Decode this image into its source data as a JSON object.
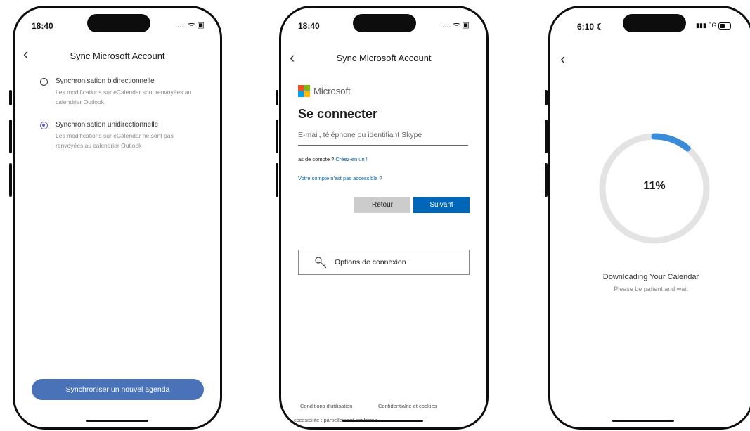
{
  "phone1": {
    "status": {
      "time": "18:40",
      "icons": "..... ᯤ ▣"
    },
    "nav": {
      "back_glyph": "‹",
      "title": "Sync Microsoft Account"
    },
    "options": [
      {
        "title": "Synchronisation bidirectionnelle",
        "desc": "Les modifications sur eCalendar sont renvoyées au calendrier Outlook.",
        "selected": false
      },
      {
        "title": "Synchronisation unidirectionnelle",
        "desc": "Les modifications sur eCalendar ne sont pas renvoyées au calendrier Outlook",
        "selected": true
      }
    ],
    "primary_button": "Synchroniser un nouvel agenda"
  },
  "phone2": {
    "status": {
      "time": "18:40",
      "icons": "..... ᯤ ▣"
    },
    "nav": {
      "back_glyph": "‹",
      "title": "Sync Microsoft Account"
    },
    "brand": "Microsoft",
    "heading": "Se connecter",
    "email_placeholder": "E-mail, téléphone ou identifiant Skype",
    "no_account_prefix": "as de compte ? ",
    "create_link": "Créez-en un !",
    "inaccessible_link": "Votre compte n'est pas accessible ?",
    "back_button": "Retour",
    "next_button": "Suivant",
    "signin_options": "Options de connexion",
    "footer_terms": "Conditions d'utilisation",
    "footer_privacy": "Confidentialité et cookies",
    "footer_access": "ccessibilité : partiellement conforme",
    "footer_more": "· · ·"
  },
  "phone3": {
    "status": {
      "time": "6:10",
      "moon": "☾",
      "signal": "5G"
    },
    "nav": {
      "back_glyph": "‹"
    },
    "progress_percent": 11,
    "progress_label": "11%",
    "title": "Downloading Your Calendar",
    "subtitle": "Please be patient and wait",
    "colors": {
      "track": "#e3e3e3",
      "arc": "#3a8bd8"
    }
  }
}
